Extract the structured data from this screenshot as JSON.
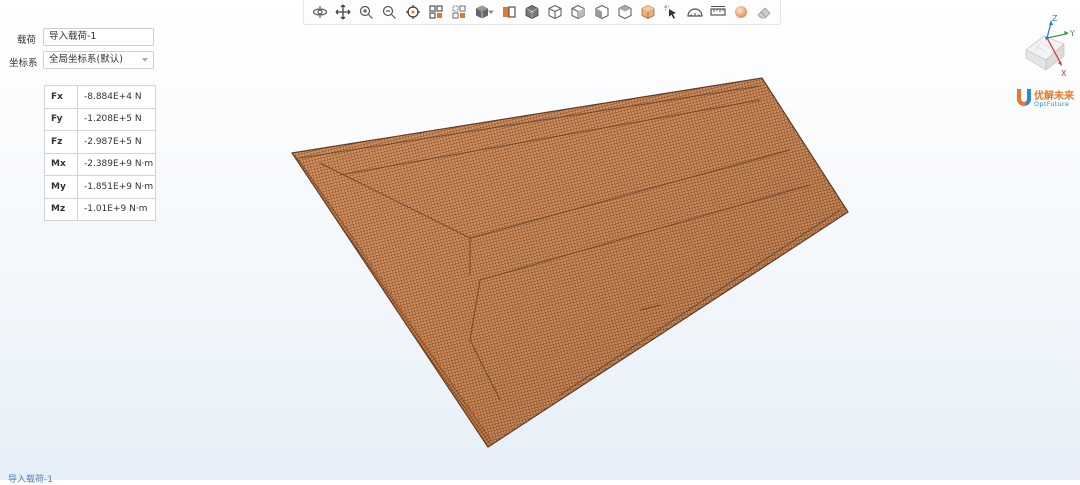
{
  "toolbar": {
    "icons": [
      "rotate-icon",
      "pan-icon",
      "zoom-in-icon",
      "zoom-out-icon",
      "target-icon",
      "fit-all-icon",
      "fit-selection-icon",
      "view-cube-icon",
      "caret-down-icon",
      "section-view-icon",
      "wireframe-icon",
      "front-view-icon",
      "back-view-icon",
      "left-view-icon",
      "right-view-icon",
      "iso-view-icon",
      "pick-icon",
      "protractor-icon",
      "ruler-icon",
      "sphere-icon",
      "eraser-icon"
    ]
  },
  "form": {
    "load_label": "载荷",
    "load_value": "导入载荷-1",
    "coord_label": "坐标系",
    "coord_value": "全局坐标系(默认)"
  },
  "loads": [
    {
      "key": "Fx",
      "value": "-8.884E+4 N"
    },
    {
      "key": "Fy",
      "value": "-1.208E+5 N"
    },
    {
      "key": "Fz",
      "value": "-2.987E+5 N"
    },
    {
      "key": "Mx",
      "value": "-2.389E+9 N·m"
    },
    {
      "key": "My",
      "value": "-1.851E+9 N·m"
    },
    {
      "key": "Mz",
      "value": "-1.01E+9 N·m"
    }
  ],
  "triad": {
    "x": "X",
    "y": "Y",
    "z": "Z"
  },
  "logo": {
    "cn": "优解未来",
    "en": "OptFuture"
  },
  "status": {
    "text": "导入载荷-1"
  },
  "colors": {
    "mesh": "#d8864a",
    "mesh_dark": "#6a4632",
    "accent": "#2a8bd0",
    "brand": "#e8782b"
  }
}
